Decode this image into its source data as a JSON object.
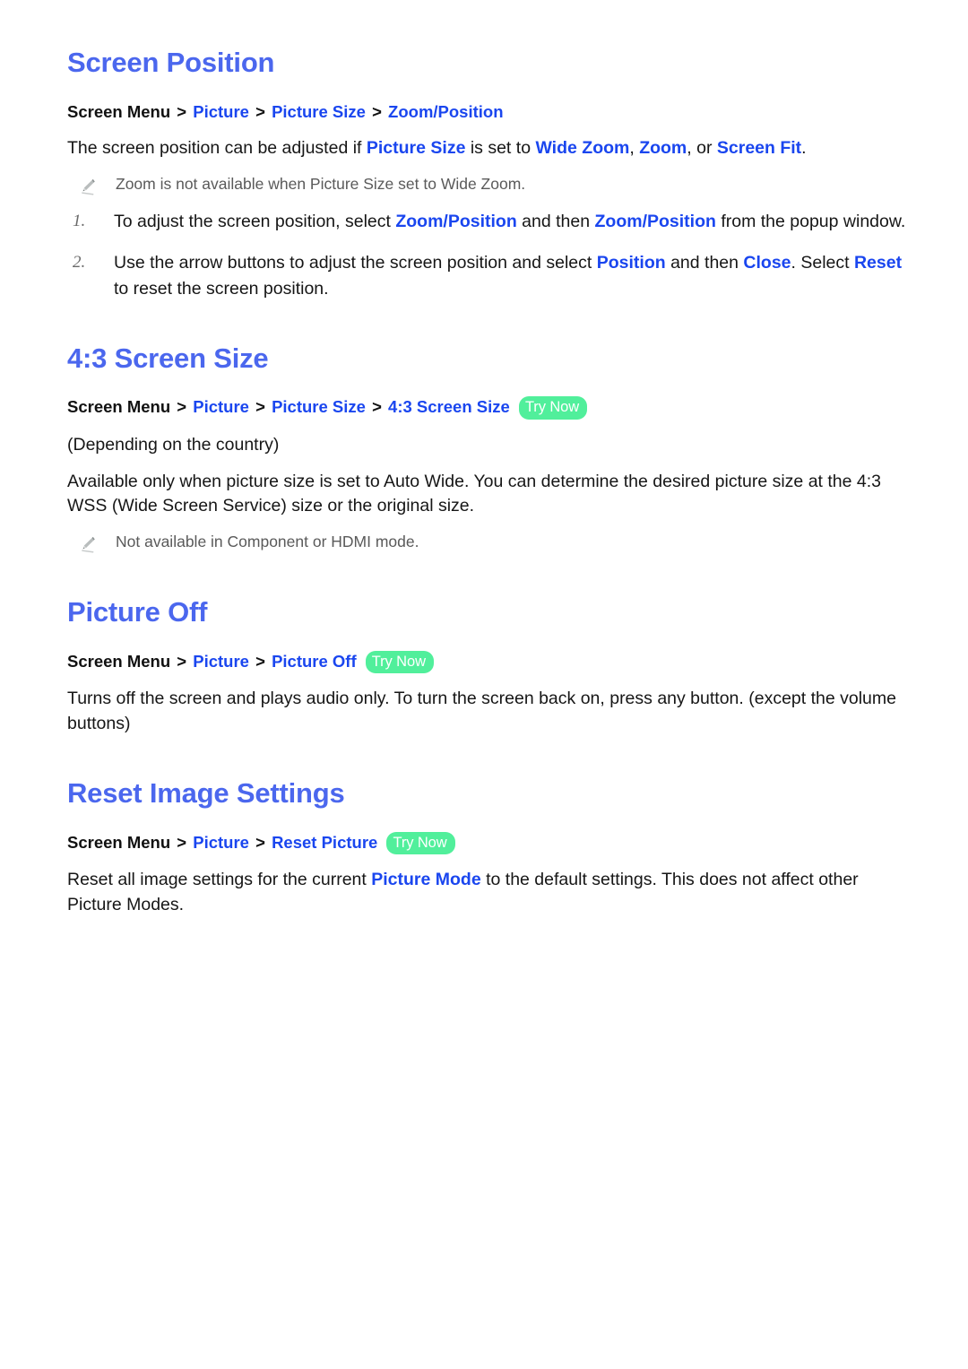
{
  "document": {
    "page_background": "#ffffff",
    "heading_color": "#4b67ee",
    "link_color": "#1a46ef",
    "badge_color": "#51ef9b",
    "note_color": "#5a5a5a"
  },
  "sections": [
    {
      "title": "Screen Position",
      "breadcrumb": {
        "root": "Screen Menu",
        "sep": ">",
        "links": [
          "Picture",
          "Picture Size",
          "Zoom/Position"
        ],
        "try_now": null
      },
      "intro": {
        "t1": "The screen position can be adjusted if ",
        "h1": "Picture Size",
        "t2": " is set to ",
        "h2": "Wide Zoom",
        "t3": ", ",
        "h3": "Zoom",
        "t4": ", or ",
        "h4": "Screen Fit",
        "t5": "."
      },
      "note": "Zoom is not available when Picture Size set to Wide Zoom.",
      "steps": [
        {
          "num": "1.",
          "t1": "To adjust the screen position, select ",
          "h1": "Zoom/Position",
          "t2": " and then ",
          "h2": "Zoom/Position",
          "t3": " from the popup window."
        },
        {
          "num": "2.",
          "t1": "Use the arrow buttons to adjust the screen position and select ",
          "h1": "Position",
          "t2": " and then ",
          "h2": "Close",
          "t3": ". Select ",
          "h3": "Reset",
          "t4": " to reset the screen position."
        }
      ]
    },
    {
      "title": "4:3 Screen Size",
      "breadcrumb": {
        "root": "Screen Menu",
        "sep": ">",
        "links": [
          "Picture",
          "Picture Size",
          "4:3 Screen Size"
        ],
        "try_now": "Try Now"
      },
      "depends": "(Depending on the country)",
      "body": "Available only when picture size is set to Auto Wide. You can determine the desired picture size at the 4:3 WSS (Wide Screen Service) size or the original size.",
      "note": "Not available in Component or HDMI mode."
    },
    {
      "title": "Picture Off",
      "breadcrumb": {
        "root": "Screen Menu",
        "sep": ">",
        "links": [
          "Picture",
          "Picture Off"
        ],
        "try_now": "Try Now"
      },
      "body": "Turns off the screen and plays audio only. To turn the screen back on, press any button. (except the volume buttons)"
    },
    {
      "title": "Reset Image Settings",
      "breadcrumb": {
        "root": "Screen Menu",
        "sep": ">",
        "links": [
          "Picture",
          "Reset Picture"
        ],
        "try_now": "Try Now"
      },
      "body": {
        "t1": "Reset all image settings for the current ",
        "h1": "Picture Mode",
        "t2": " to the default settings. This does not affect other Picture Modes."
      }
    }
  ],
  "icons": {
    "note": "pencil-icon"
  }
}
